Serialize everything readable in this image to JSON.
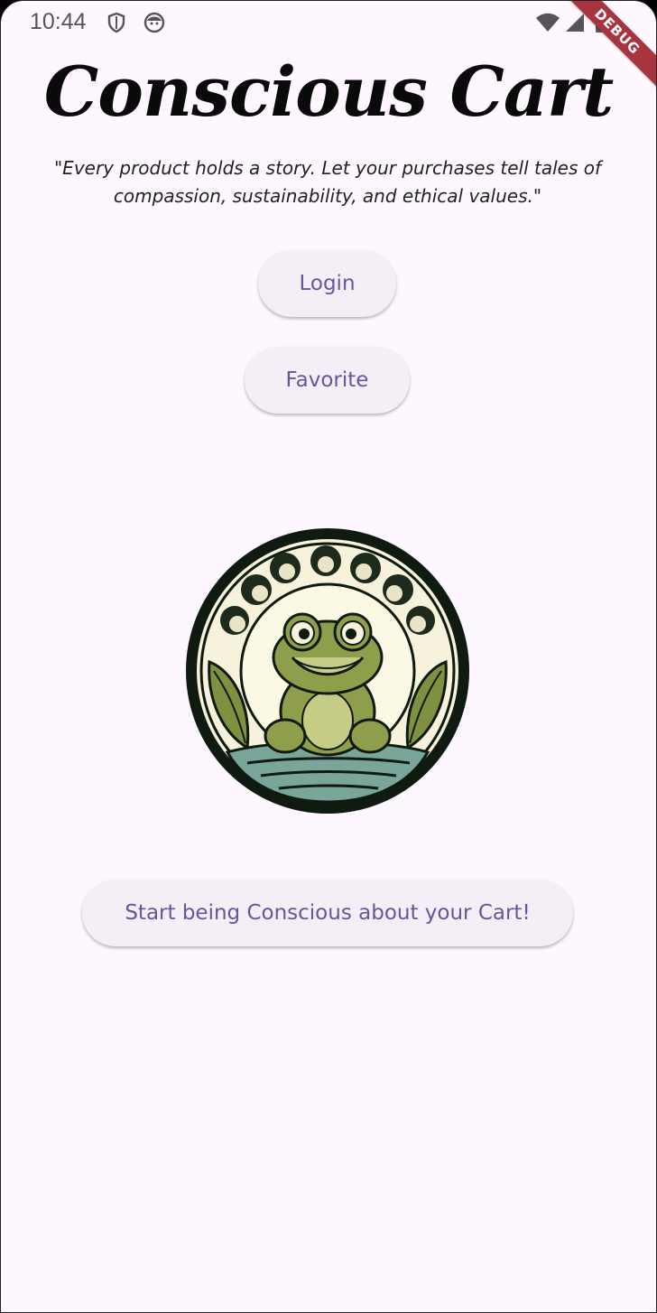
{
  "status_bar": {
    "time": "10:44",
    "icons": [
      "shield-icon",
      "face-icon",
      "wifi-icon",
      "signal-icon",
      "battery-icon"
    ]
  },
  "debug_banner": "DEBUG",
  "app": {
    "title": "Conscious Cart",
    "tagline": "\"Every product holds a story. Let your purchases tell tales of compassion, sustainability, and ethical values.\""
  },
  "buttons": {
    "login": "Login",
    "favorite": "Favorite",
    "start": "Start being Conscious about your Cart!"
  },
  "colors": {
    "background": "#fef7ff",
    "button_bg": "#f4eff7",
    "button_text": "#65569e",
    "debug_ribbon": "#a8353d"
  }
}
